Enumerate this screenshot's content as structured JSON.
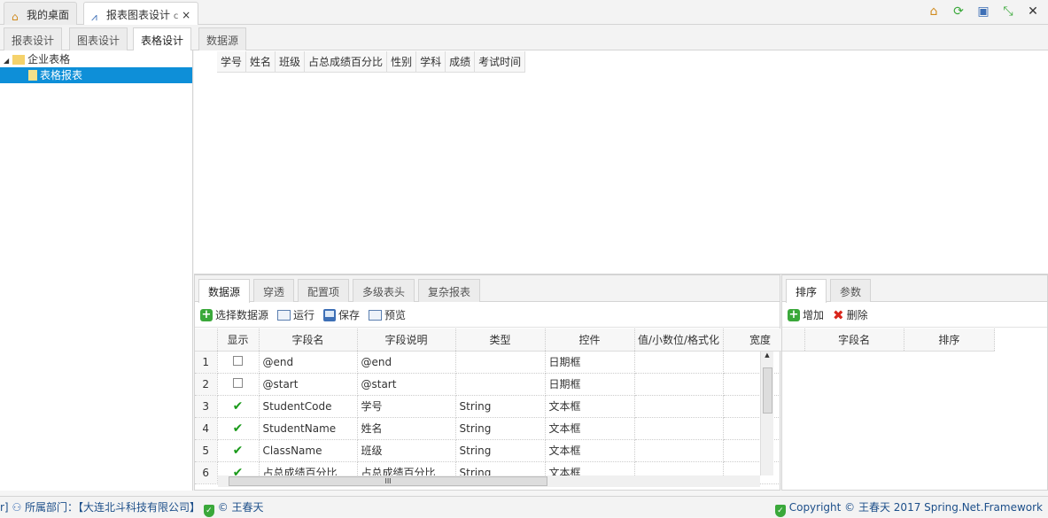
{
  "top_tabs": [
    {
      "label": "我的桌面"
    },
    {
      "label": "报表图表设计",
      "refresh": "c",
      "close": "×"
    }
  ],
  "window_icons": [
    "home-icon",
    "refresh-icon",
    "fullscreen-icon",
    "collapse-icon",
    "close-icon"
  ],
  "window_close": "✕",
  "sub_tabs": [
    "报表设计",
    "图表设计",
    "表格设计",
    "数据源"
  ],
  "tree": {
    "root": "企业表格",
    "child": "表格报表"
  },
  "preview_columns": [
    "学号",
    "姓名",
    "班级",
    "占总成绩百分比",
    "性别",
    "学科",
    "成绩",
    "考试时间"
  ],
  "bottom_left": {
    "tabs": [
      "数据源",
      "穿透",
      "配置项",
      "多级表头",
      "复杂报表"
    ],
    "toolbar": {
      "select": "选择数据源",
      "run": "运行",
      "save": "保存",
      "preview": "预览"
    },
    "columns": [
      "显示",
      "字段名",
      "字段说明",
      "类型",
      "控件",
      "值/小数位/格式化",
      "宽度"
    ],
    "rows": [
      {
        "n": "1",
        "show": false,
        "name": "@end",
        "desc": "@end",
        "type": "",
        "ctrl": "日期框"
      },
      {
        "n": "2",
        "show": false,
        "name": "@start",
        "desc": "@start",
        "type": "",
        "ctrl": "日期框"
      },
      {
        "n": "3",
        "show": true,
        "name": "StudentCode",
        "desc": "学号",
        "type": "String",
        "ctrl": "文本框"
      },
      {
        "n": "4",
        "show": true,
        "name": "StudentName",
        "desc": "姓名",
        "type": "String",
        "ctrl": "文本框"
      },
      {
        "n": "5",
        "show": true,
        "name": "ClassName",
        "desc": "班级",
        "type": "String",
        "ctrl": "文本框"
      },
      {
        "n": "6",
        "show": true,
        "name": "占总成绩百分比",
        "desc": "占总成绩百分比",
        "type": "String",
        "ctrl": "文本框"
      }
    ],
    "check_glyph": "✔"
  },
  "bottom_right": {
    "tabs": [
      "排序",
      "参数"
    ],
    "toolbar": {
      "add": "增加",
      "delete": "删除"
    },
    "columns": [
      "字段名",
      "排序"
    ]
  },
  "status": {
    "left_prefix": "r]",
    "dept": "所属部门：【大连北斗科技有限公司】",
    "user": "© 王春天",
    "copyright": "Copyright © 王春天 2017 Spring.Net.Framework"
  }
}
